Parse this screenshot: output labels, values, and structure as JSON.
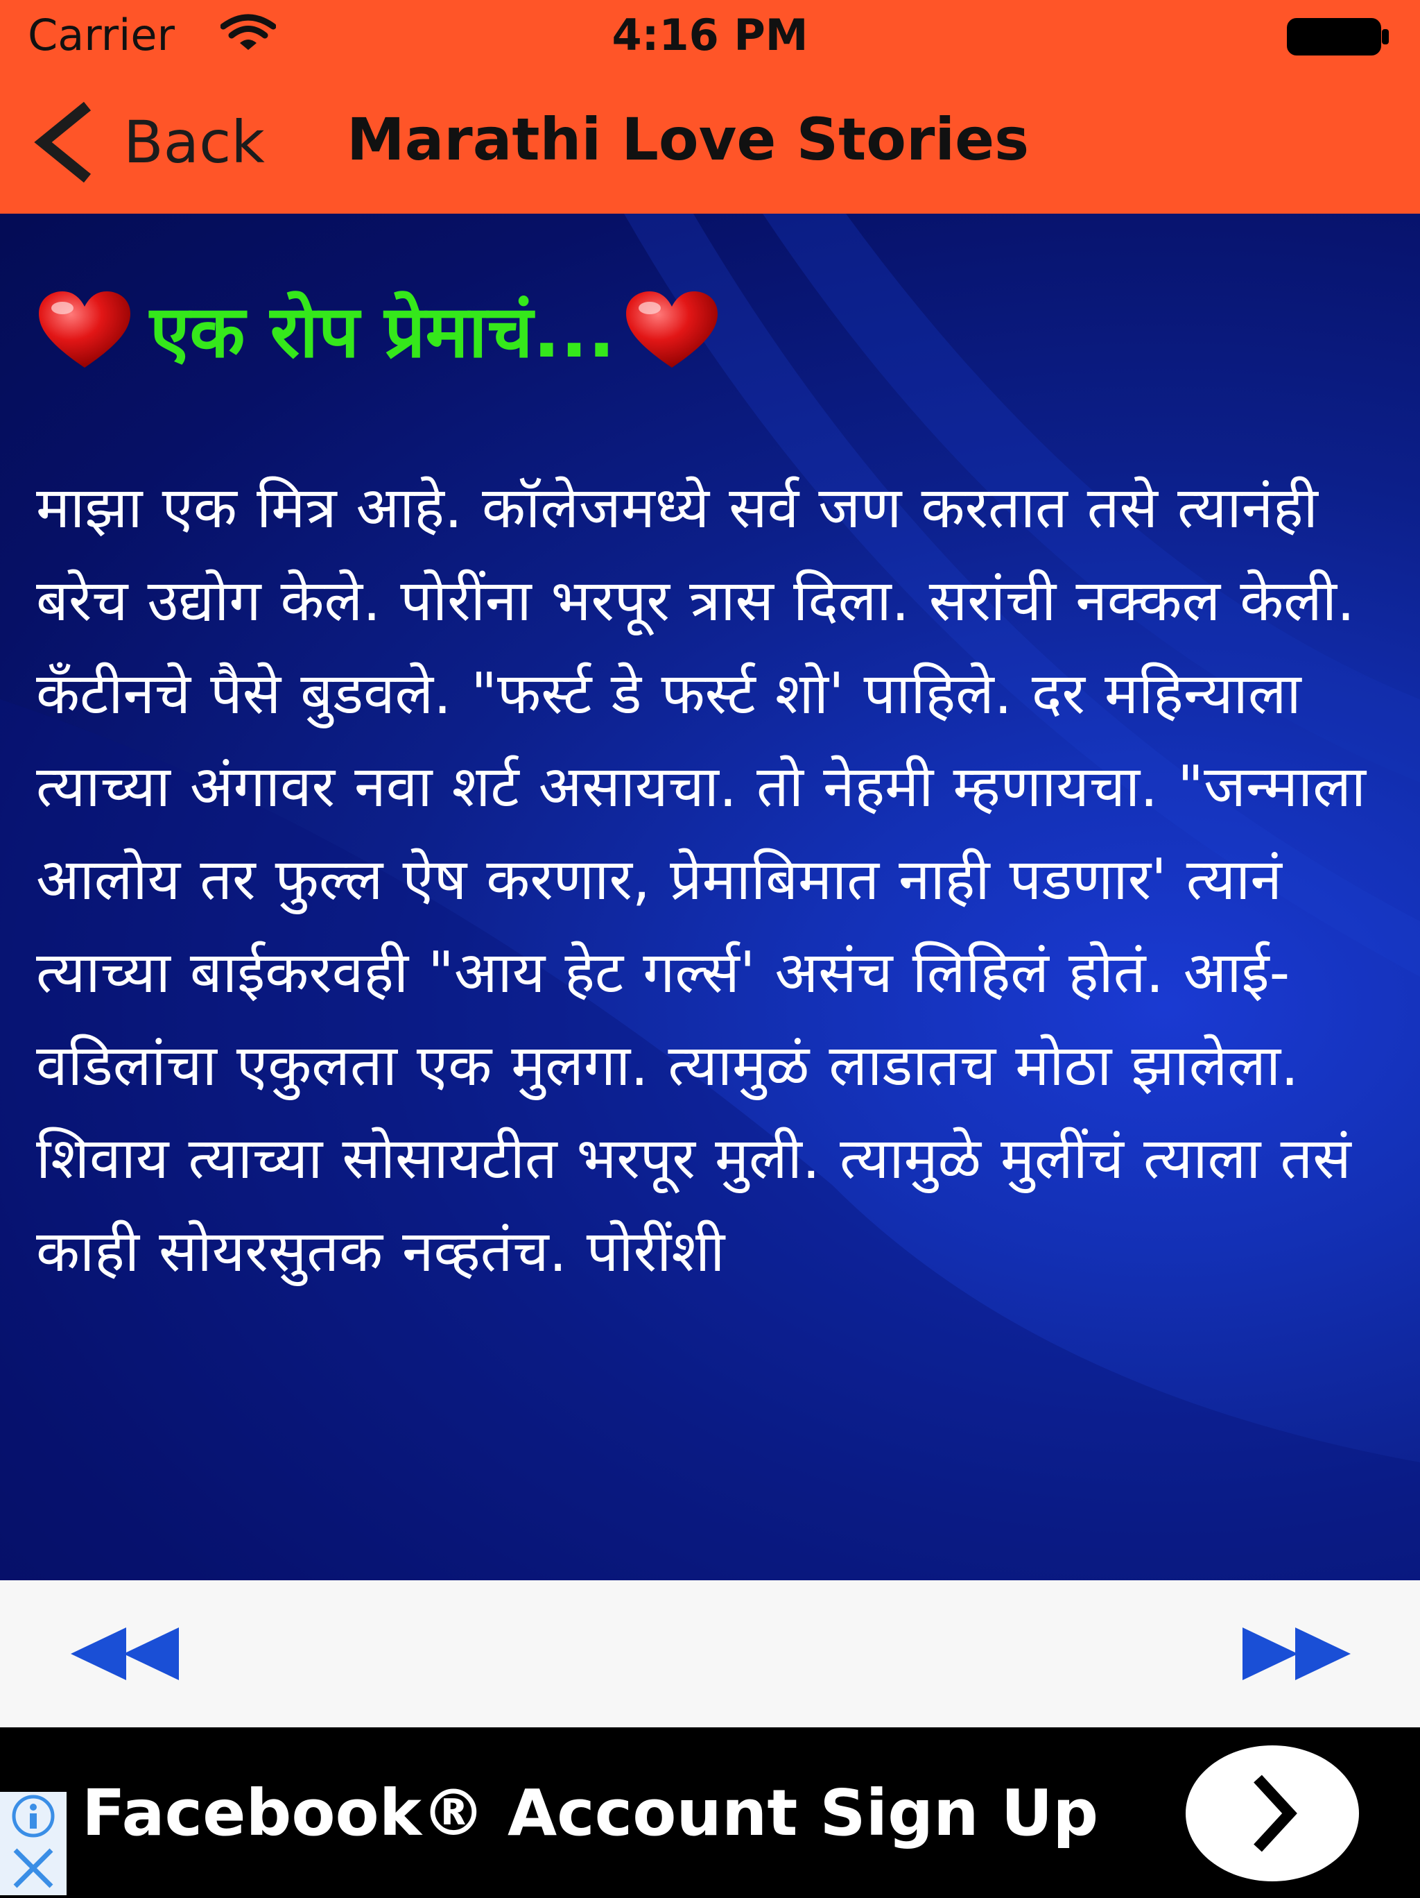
{
  "status_bar": {
    "carrier": "Carrier",
    "time": "4:16 PM"
  },
  "nav": {
    "back_label": "Back",
    "title": "Marathi Love Stories"
  },
  "story": {
    "title": "एक रोप प्रेमाचं...",
    "body": "माझा एक मित्र आहे. कॉलेजमध्ये सर्व जण करतात तसे त्यानंही बरेच उद्योग केले. पोरींना भरपूर त्रास दिला. सरांची नक्कल केली. कँटीनचे पैसे बुडवले. \"फर्स्ट डे फर्स्ट शो' पाहिले. दर महिन्याला त्याच्या अंगावर नवा शर्ट असायचा. तो नेहमी म्हणायचा. \"जन्माला आलोय तर फुल्ल ऐष करणार, प्रेमाबिमात नाही पडणार' त्यानं त्याच्या बाईकरवही \"आय हेट गर्ल्स' असंच लिहिलं होतं. आई-वडिलांचा एकुलता एक मुलगा. त्यामुळं लाडातच मोठा झालेला. शिवाय त्याच्या सोसायटीत भरपूर मुली. त्यामुळे मुलींचं त्याला तसं काही सोयरसुतक नव्हतंच. पोरींशी"
  },
  "pager": {
    "prev_icon": "rewind-icon",
    "next_icon": "fast-forward-icon",
    "accent": "#1a4fd6"
  },
  "ad": {
    "text": "Facebook® Account Sign Up"
  },
  "colors": {
    "header": "#ff5528",
    "title_green": "#35e81b",
    "content_blue": "#0c1f8a"
  }
}
